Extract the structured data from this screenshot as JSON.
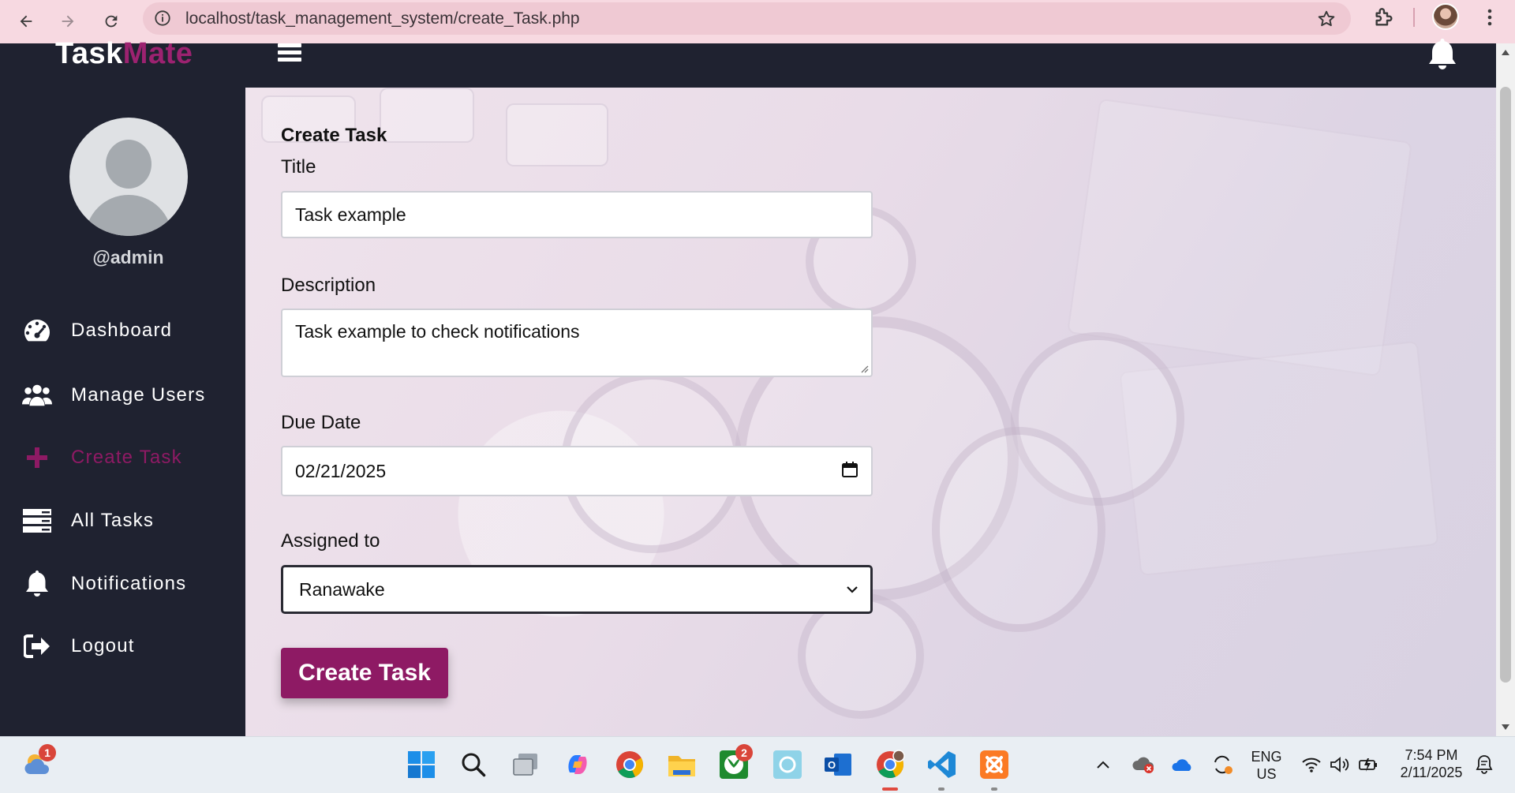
{
  "browser": {
    "url": "localhost/task_management_system/create_Task.php"
  },
  "app": {
    "brand_part1": "Task",
    "brand_part2": "Mate"
  },
  "sidebar": {
    "username": "@admin",
    "items": [
      {
        "label": "Dashboard",
        "icon": "dashboard-gauge-icon",
        "active": false
      },
      {
        "label": "Manage Users",
        "icon": "users-icon",
        "active": false
      },
      {
        "label": "Create Task",
        "icon": "plus-icon",
        "active": true
      },
      {
        "label": "All Tasks",
        "icon": "tasks-list-icon",
        "active": false
      },
      {
        "label": "Notifications",
        "icon": "bell-icon",
        "active": false
      },
      {
        "label": "Logout",
        "icon": "logout-icon",
        "active": false
      }
    ]
  },
  "form": {
    "heading": "Create Task",
    "title_label": "Title",
    "title_value": "Task example",
    "description_label": "Description",
    "description_value": "Task example to check notifications",
    "due_date_label": "Due Date",
    "due_date_value": "02/21/2025",
    "assigned_label": "Assigned to",
    "assigned_value": "Ranawake",
    "submit_label": "Create Task"
  },
  "taskbar": {
    "weather_badge": "1",
    "xbox_badge": "2",
    "language_line1": "ENG",
    "language_line2": "US",
    "time": "7:54 PM",
    "date": "2/11/2025"
  },
  "colors": {
    "accent": "#8e1a64",
    "sidebar_bg": "#1f2230",
    "chrome_bg": "#f7d9e1"
  }
}
